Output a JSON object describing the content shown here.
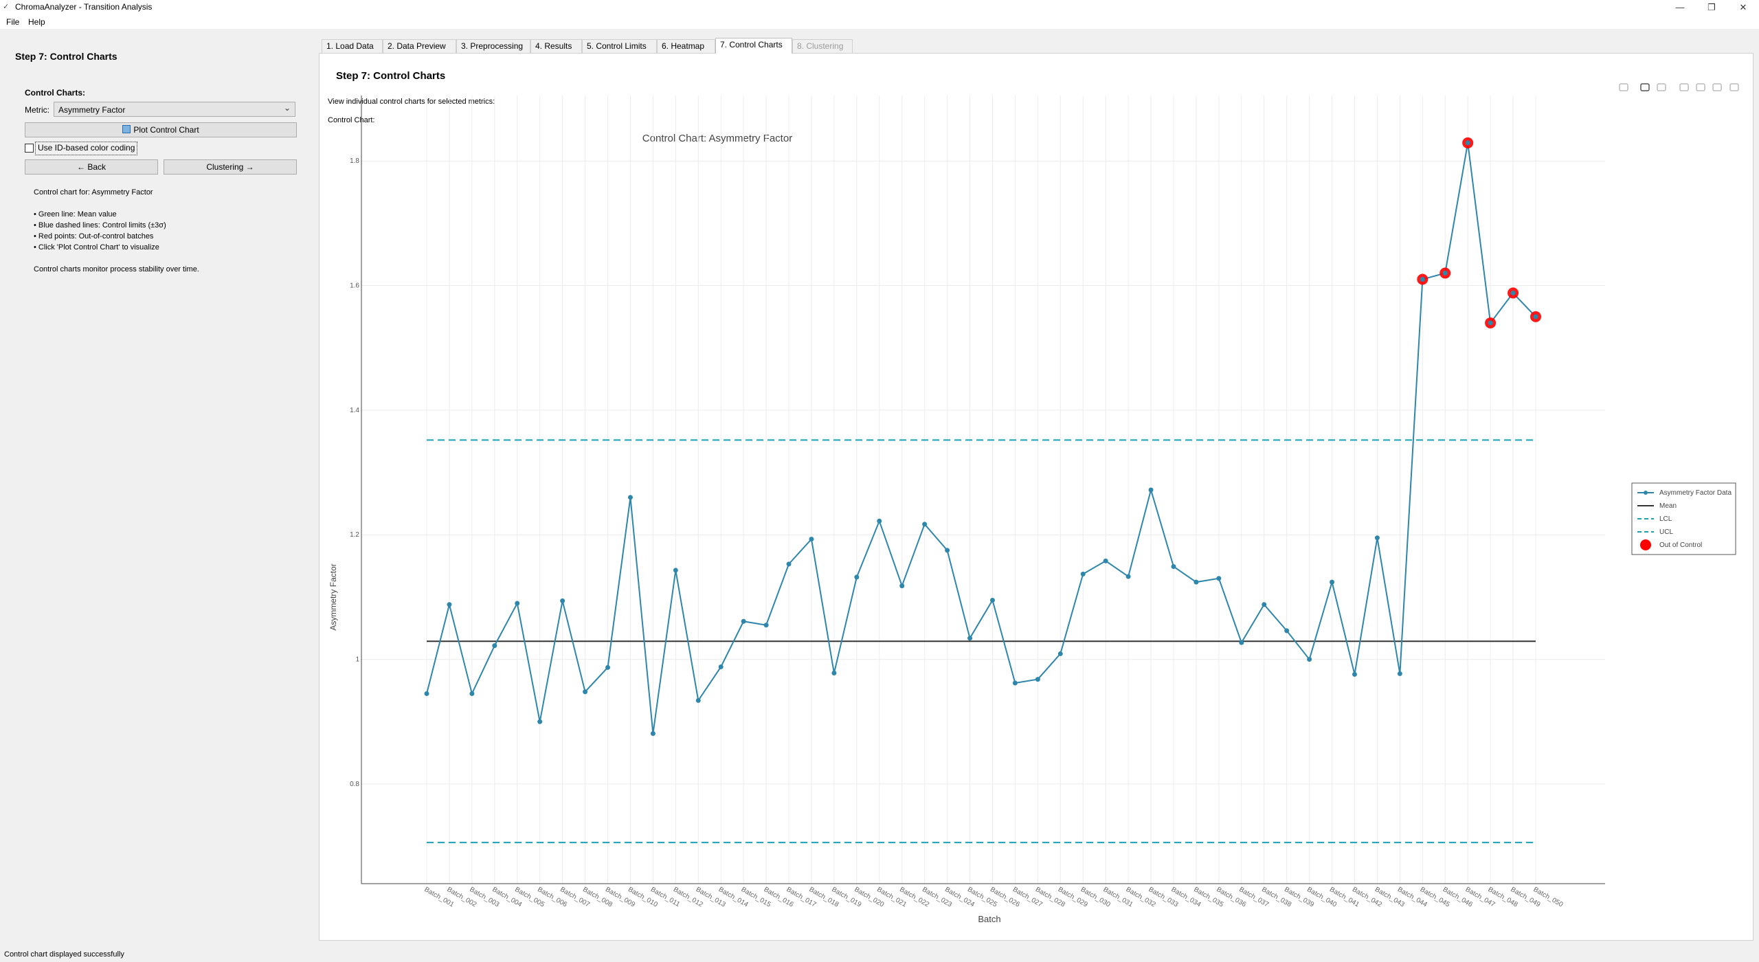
{
  "window": {
    "app_icon": "✓",
    "title": "ChromaAnalyzer - Transition Analysis"
  },
  "menu": [
    "File",
    "Help"
  ],
  "left_panel": {
    "step_title": "Step 7: Control Charts",
    "control_charts_label": "Control Charts:",
    "metric_label": "Metric:",
    "metric_value": "Asymmetry Factor",
    "plot_button": "Plot Control Chart",
    "checkbox_label": "Use ID-based color coding",
    "checkbox_checked": false,
    "back_button": "← Back",
    "clustering_button": "Clustering →",
    "info": {
      "line1": "Control chart for: Asymmetry Factor",
      "line2": "• Green line: Mean value",
      "line3": "• Blue dashed lines: Control limits (±3σ)",
      "line4": "• Red points: Out-of-control batches",
      "line5": "• Click 'Plot Control Chart' to visualize",
      "line6": "Control charts monitor process stability over time."
    }
  },
  "tabs": [
    {
      "label": "1. Load Data",
      "state": "normal"
    },
    {
      "label": "2. Data Preview",
      "state": "normal"
    },
    {
      "label": "3. Preprocessing",
      "state": "normal"
    },
    {
      "label": "4. Results",
      "state": "normal"
    },
    {
      "label": "5. Control Limits",
      "state": "normal"
    },
    {
      "label": "6. Heatmap",
      "state": "normal"
    },
    {
      "label": "7. Control Charts",
      "state": "active"
    },
    {
      "label": "8. Clustering",
      "state": "disabled"
    }
  ],
  "content": {
    "title": "Step 7: Control Charts",
    "description": "View individual control charts for selected metrics:",
    "chart_label": "Control Chart:"
  },
  "toolbar_icons": [
    "camera-icon",
    "zoom-icon",
    "box-select-icon",
    "zoom-in-icon",
    "zoom-out-icon",
    "autoscale-icon",
    "home-icon"
  ],
  "chart_data": {
    "type": "line",
    "title": "Control Chart: Asymmetry Factor",
    "xlabel": "Batch",
    "ylabel": "Asymmetry Factor",
    "ylim": [
      0.64,
      1.905
    ],
    "yticks": [
      0.8,
      1,
      1.2,
      1.4,
      1.6,
      1.8
    ],
    "ytick_labels": [
      "0.8",
      "1",
      "1.2",
      "1.4",
      "1.6",
      "1.8"
    ],
    "grid": true,
    "legend_position": "right",
    "categories": [
      "Batch_001",
      "Batch_002",
      "Batch_003",
      "Batch_004",
      "Batch_005",
      "Batch_006",
      "Batch_007",
      "Batch_008",
      "Batch_009",
      "Batch_010",
      "Batch_011",
      "Batch_012",
      "Batch_013",
      "Batch_014",
      "Batch_015",
      "Batch_016",
      "Batch_017",
      "Batch_018",
      "Batch_019",
      "Batch_020",
      "Batch_021",
      "Batch_022",
      "Batch_023",
      "Batch_024",
      "Batch_025",
      "Batch_026",
      "Batch_027",
      "Batch_028",
      "Batch_029",
      "Batch_030",
      "Batch_031",
      "Batch_032",
      "Batch_033",
      "Batch_034",
      "Batch_035",
      "Batch_036",
      "Batch_037",
      "Batch_038",
      "Batch_039",
      "Batch_040",
      "Batch_041",
      "Batch_042",
      "Batch_043",
      "Batch_044",
      "Batch_045",
      "Batch_046",
      "Batch_047",
      "Batch_048",
      "Batch_049",
      "Batch_050"
    ],
    "series": [
      {
        "name": "Asymmetry Factor Data",
        "color": "#2e86ab",
        "values": [
          0.945,
          1.088,
          0.945,
          1.022,
          1.09,
          0.9,
          1.094,
          0.948,
          0.987,
          1.26,
          0.881,
          1.143,
          0.934,
          0.988,
          1.061,
          1.055,
          1.153,
          1.193,
          0.978,
          1.132,
          1.222,
          1.118,
          1.217,
          1.175,
          1.034,
          1.095,
          0.962,
          0.968,
          1.009,
          1.137,
          1.158,
          1.133,
          1.272,
          1.149,
          1.124,
          1.13,
          1.027,
          1.088,
          1.046,
          1.0,
          1.124,
          0.976,
          1.195,
          0.977,
          1.61,
          1.62,
          1.829,
          1.54,
          1.588,
          1.55
        ]
      }
    ],
    "mean": {
      "name": "Mean",
      "value": 1.029,
      "color": "#333333"
    },
    "lcl": {
      "name": "LCL",
      "value": 0.706,
      "color": "#17a2b8"
    },
    "ucl": {
      "name": "UCL",
      "value": 1.352,
      "color": "#17a2b8"
    },
    "out_of_control": {
      "name": "Out of Control",
      "color": "#ff0000",
      "indices": [
        44,
        45,
        46,
        47,
        48,
        49
      ]
    }
  },
  "status": "Control chart displayed successfully"
}
